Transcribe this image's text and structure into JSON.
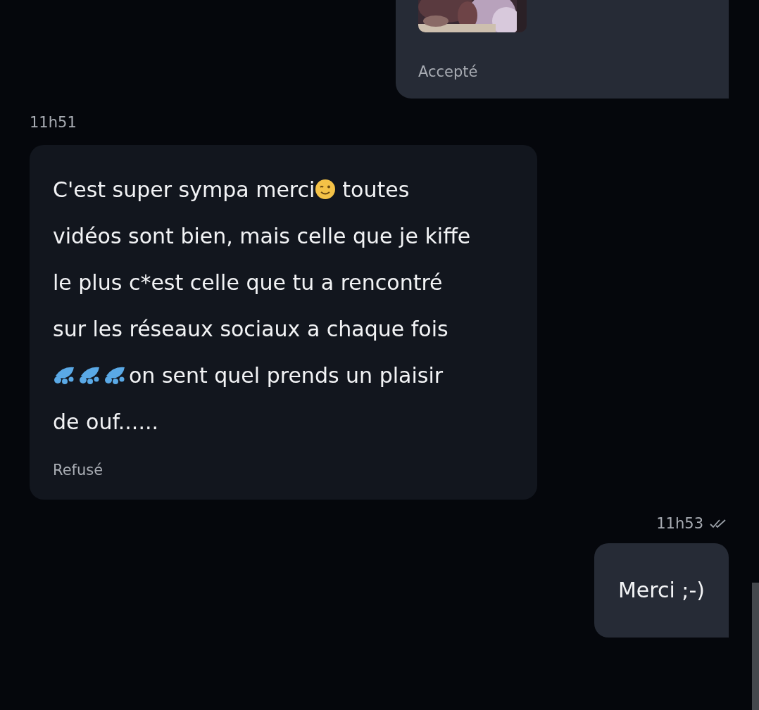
{
  "messages": [
    {
      "outgoing": true,
      "kind": "media",
      "status": "Accepté"
    },
    {
      "outgoing": false,
      "kind": "text",
      "time": "11h51",
      "lines": [
        [
          {
            "kind": "text",
            "text": "C'est super sympa merci"
          },
          {
            "kind": "wink"
          },
          {
            "kind": "text",
            "text": "toutes"
          }
        ],
        [
          {
            "kind": "text",
            "text": "vidéos sont bien, mais celle que je kiffe"
          }
        ],
        [
          {
            "kind": "text",
            "text": "le plus c*est celle que tu a rencontré"
          }
        ],
        [
          {
            "kind": "text",
            "text": "sur les réseaux sociaux a chaque fois"
          }
        ],
        [
          {
            "kind": "droplets"
          },
          {
            "kind": "droplets"
          },
          {
            "kind": "droplets"
          },
          {
            "kind": "text",
            "text": "on sent quel prends un plaisir"
          }
        ],
        [
          {
            "kind": "text",
            "text": "de ouf......"
          }
        ]
      ],
      "status": "Refusé"
    },
    {
      "outgoing": true,
      "kind": "text",
      "time": "11h53",
      "read": true,
      "lines": [
        [
          {
            "kind": "text",
            "text": "Merci ;-)"
          }
        ]
      ]
    }
  ]
}
